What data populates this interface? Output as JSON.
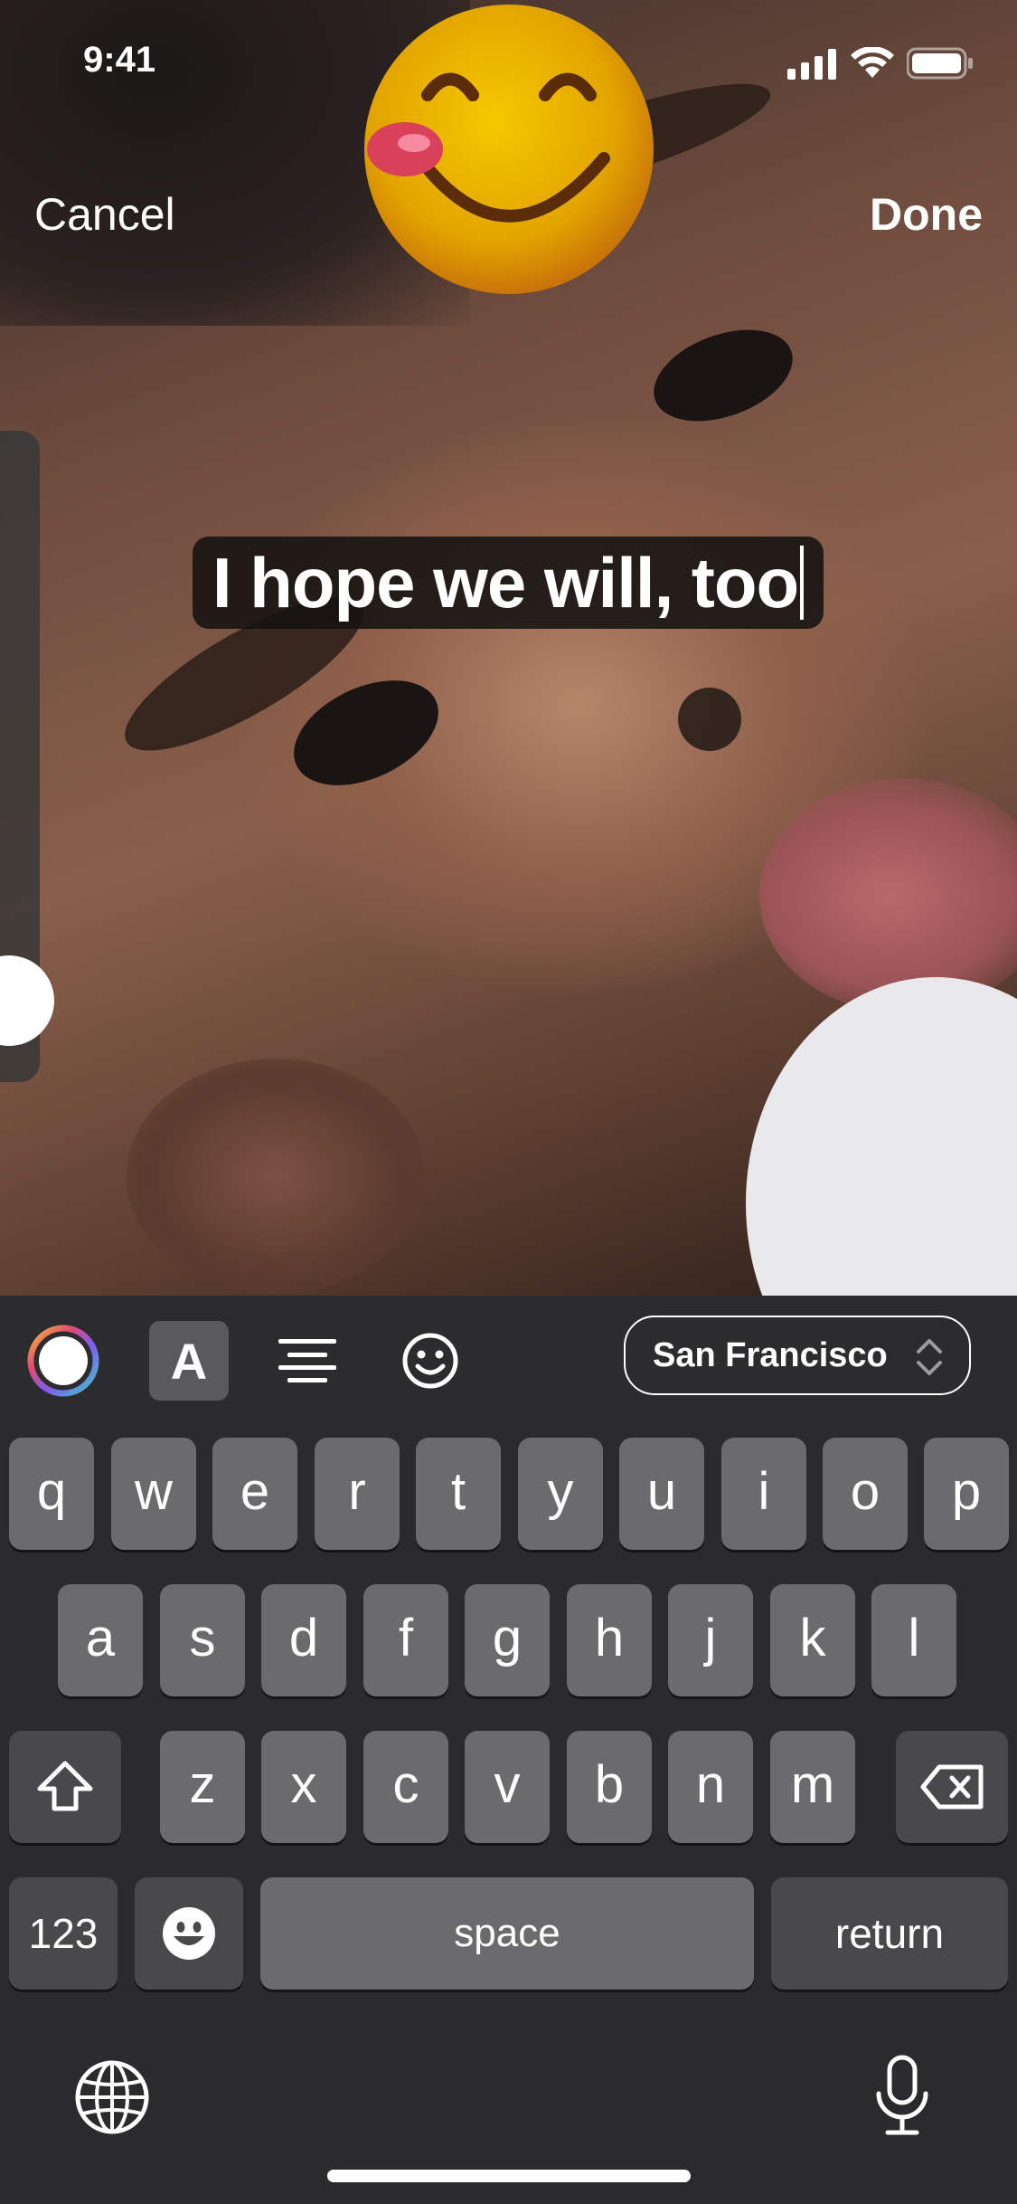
{
  "status_bar": {
    "time": "9:41"
  },
  "header": {
    "cancel_label": "Cancel",
    "done_label": "Done"
  },
  "editor": {
    "text": "I hope we will, too"
  },
  "toolbar": {
    "color_icon": "color-wheel-icon",
    "text_style_label": "A",
    "align_icon": "align-center-icon",
    "emoji_icon": "smiley-icon",
    "font_name": "San Francisco"
  },
  "keyboard": {
    "row1": [
      "q",
      "w",
      "e",
      "r",
      "t",
      "y",
      "u",
      "i",
      "o",
      "p"
    ],
    "row2": [
      "a",
      "s",
      "d",
      "f",
      "g",
      "h",
      "j",
      "k",
      "l"
    ],
    "row3": [
      "z",
      "x",
      "c",
      "v",
      "b",
      "n",
      "m"
    ],
    "numbers_label": "123",
    "space_label": "space",
    "return_label": "return"
  }
}
